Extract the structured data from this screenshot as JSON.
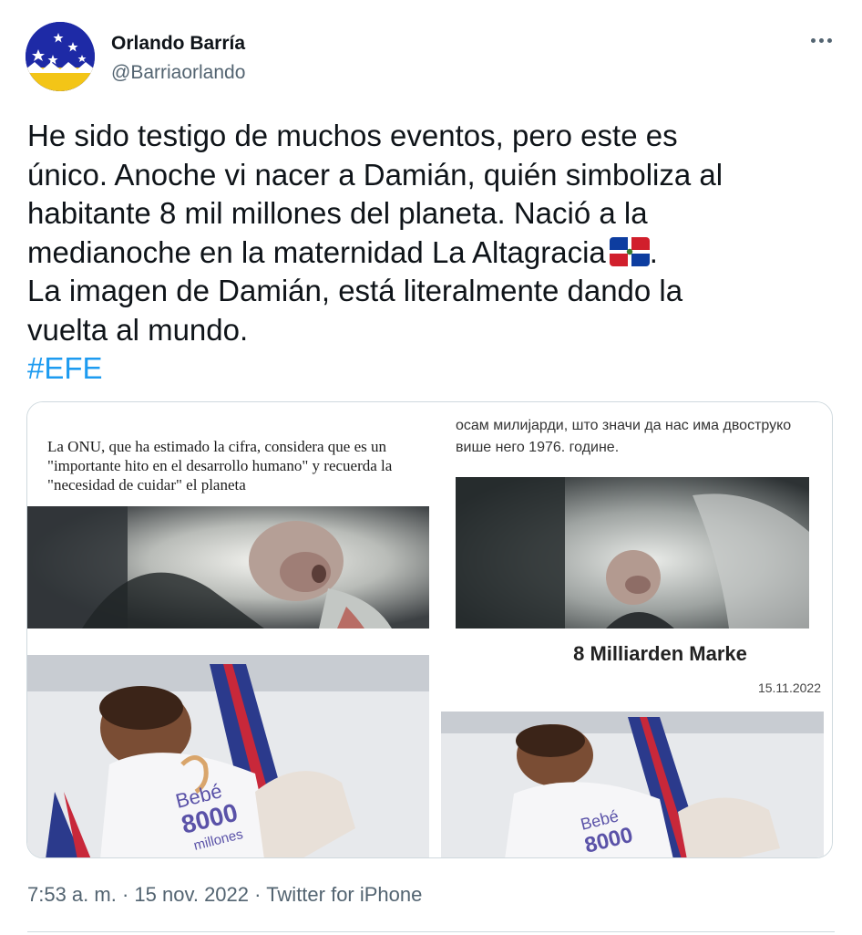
{
  "author": {
    "name": "Orlando Barría",
    "handle": "@Barriaorlando",
    "avatar_icon": "stars-avatar-icon"
  },
  "tweet": {
    "lines": [
      "He sido testigo de muchos eventos, pero este es",
      "único. Anoche vi nacer a Damián, quién simboliza al",
      "habitante 8 mil millones del planeta. Nació a la",
      "medianoche en la maternidad La Altagracia",
      "La imagen de Damián, está literalmente dando la",
      "vuelta al mundo."
    ],
    "flag_icon": "dominican-republic-flag-icon",
    "line4_suffix": ".",
    "hashtag": "#EFE"
  },
  "media": {
    "tile1": {
      "caption": "La ONU, que ha estimado la cifra, considera que es un \"importante hito en el desarrollo humano\" y recuerda la \"necesidad de cuidar\" el planeta"
    },
    "tile2": {
      "caption": "осам милијарди, што значи да нас има двоструко више него 1976. године."
    },
    "tile4": {
      "headline": "8 Milliarden Marke",
      "date": "15.11.2022"
    },
    "onesie_text": {
      "line1": "Bebé",
      "line2": "8000",
      "line3": "millones"
    }
  },
  "footer": {
    "time": "7:53 a. m.",
    "separator": "·",
    "date": "15 nov. 2022",
    "source": "Twitter for iPhone"
  },
  "colors": {
    "accent": "#1d9bf0",
    "secondary_text": "#536471",
    "border": "#cfd9de"
  }
}
